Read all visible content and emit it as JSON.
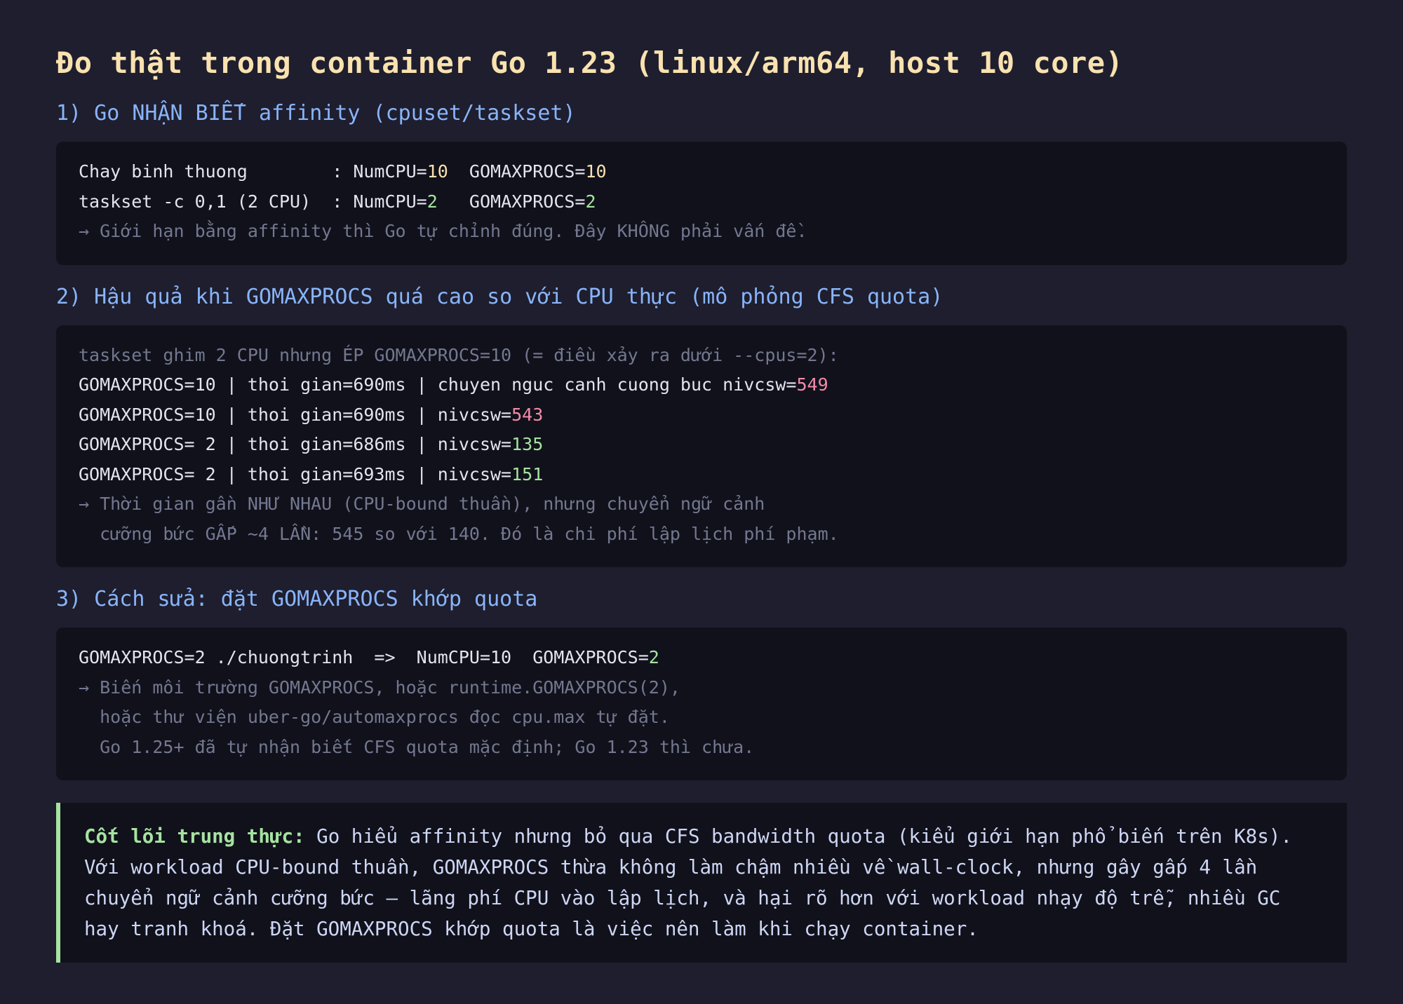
{
  "title": "Đo thật trong container Go 1.23 (linux/arm64, host 10 core)",
  "section1": {
    "title": "1) Go NHẬN BIẾT affinity (cpuset/taskset)",
    "lines": [
      {
        "prefix": "Chay binh thuong        : NumCPU=",
        "numcpu": "10",
        "mid": "  GOMAXPROCS=",
        "gomaxprocs": "10"
      },
      {
        "prefix": "taskset -c 0,1 (2 CPU)  : NumCPU=",
        "numcpu": "2",
        "mid": "   GOMAXPROCS=",
        "gomaxprocs": "2"
      }
    ],
    "note": "→ Giới hạn bằng affinity thì Go tự chỉnh đúng. Đây KHÔNG phải vấn đề."
  },
  "section2": {
    "title": "2) Hậu quả khi GOMAXPROCS quá cao so với CPU thực (mô phỏng CFS quota)",
    "intro": "taskset ghim 2 CPU nhưng ÉP GOMAXPROCS=10 (= điều xảy ra dưới --cpus=2):",
    "rows": [
      {
        "text": "GOMAXPROCS=10 | thoi gian=690ms | chuyen nguc canh cuong buc nivcsw=",
        "value": "549"
      },
      {
        "text": "GOMAXPROCS=10 | thoi gian=690ms | nivcsw=",
        "value": "543"
      },
      {
        "text": "GOMAXPROCS= 2 | thoi gian=686ms | nivcsw=",
        "value": "135"
      },
      {
        "text": "GOMAXPROCS= 2 | thoi gian=693ms | nivcsw=",
        "value": "151"
      }
    ],
    "note_lines": [
      "→ Thời gian gần NHƯ NHAU (CPU-bound thuần), nhưng chuyển ngữ cảnh",
      "  cưỡng bức GẤP ~4 LẦN: 545 so với 140. Đó là chi phí lập lịch phí phạm."
    ]
  },
  "section3": {
    "title": "3) Cách sửa: đặt GOMAXPROCS khớp quota",
    "command": "GOMAXPROCS=2 ./chuongtrinh  =>  NumCPU=10  GOMAXPROCS=",
    "command_value": "2",
    "note_lines": [
      "→ Biến môi trường GOMAXPROCS, hoặc runtime.GOMAXPROCS(2),",
      "  hoặc thư viện uber-go/automaxprocs đọc cpu.max tự đặt.",
      "  Go 1.25+ đã tự nhận biết CFS quota mặc định; Go 1.23 thì chưa."
    ]
  },
  "summary": {
    "lead": "Cốt lõi trung thực:",
    "text": " Go hiểu affinity nhưng bỏ qua CFS bandwidth quota (kiểu giới hạn phổ biến trên K8s). Với workload CPU-bound thuần, GOMAXPROCS thừa không làm chậm nhiều về wall-clock, nhưng gây gấp 4 lần chuyển ngữ cảnh cưỡng bức — lãng phí CPU vào lập lịch, và hại rõ hơn với workload nhạy độ trễ, nhiều GC hay tranh khoá. Đặt GOMAXPROCS khớp quota là việc nên làm khi chạy container."
  },
  "colors": {
    "background": "#1e1e2e",
    "block": "#11111b",
    "title": "#f9e2af",
    "section": "#89b4fa",
    "good": "#a6e3a1",
    "bad": "#f38ba8",
    "dim": "#737890"
  }
}
